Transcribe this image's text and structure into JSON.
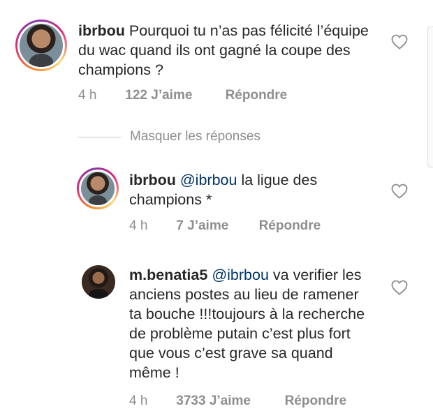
{
  "comments": [
    {
      "username": "ibrbou",
      "mention": "",
      "text": "Pourquoi tu n’as pas félicité l’équipe du wac quand ils ont gagné la coupe des champions ?",
      "time": "4 h",
      "likes": "122 J’aime",
      "reply": "Répondre"
    },
    {
      "username": "ibrbou",
      "mention": "@ibrbou",
      "text": "la ligue des champions *",
      "time": "4 h",
      "likes": "7 J’aime",
      "reply": "Répondre"
    },
    {
      "username": "m.benatia5",
      "mention": "@ibrbou",
      "text": "va verifier les anciens postes au lieu de ramener ta bouche !!!toujours à la recherche de problème putain c’est plus fort que vous c’est grave sa quand même !",
      "time": "4 h",
      "likes": "3733 J’aime",
      "reply": "Répondre"
    }
  ],
  "hide_replies": "Masquer les réponses",
  "icons": {
    "like": "heart-outline-icon"
  }
}
